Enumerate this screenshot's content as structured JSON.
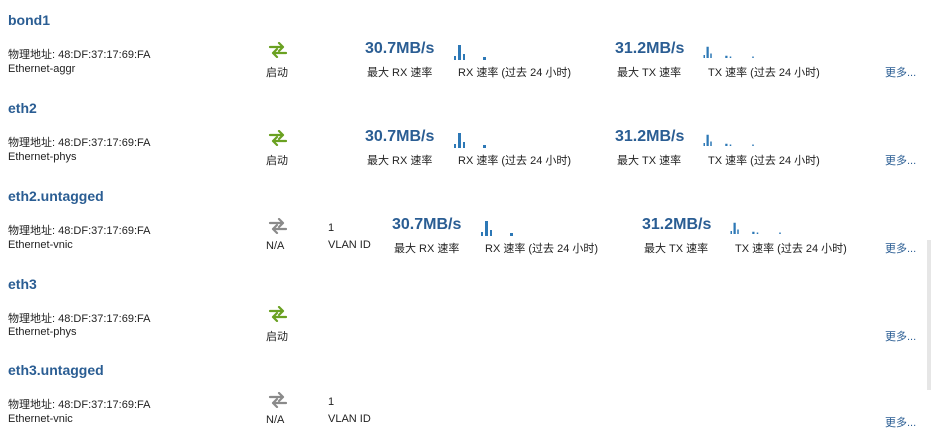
{
  "colors": {
    "link": "#2a5d93",
    "status_up": "#6aa121",
    "status_na": "#8a8a8a",
    "spark": "#2d78b6"
  },
  "labels": {
    "mac_prefix": "物理地址: ",
    "more": "更多...",
    "max_rx": "最大 RX 速率",
    "max_tx": "最大 TX 速率",
    "rx_24h": "RX 速率 (过去 24 小时)",
    "tx_24h": "TX 速率 (过去 24 小时)",
    "vlan_id": "VLAN ID"
  },
  "interfaces": [
    {
      "name": "bond1",
      "mac": "物理地址: 48:DF:37:17:69:FA",
      "type": "Ethernet-aggr",
      "status_icon": "link-up-icon",
      "status": "启动",
      "max_rx": "30.7MB/s",
      "max_tx": "31.2MB/s"
    },
    {
      "name": "eth2",
      "mac": "物理地址: 48:DF:37:17:69:FA",
      "type": "Ethernet-phys",
      "status_icon": "link-up-icon",
      "status": "启动",
      "max_rx": "30.7MB/s",
      "max_tx": "31.2MB/s"
    },
    {
      "name": "eth2.untagged",
      "mac": "物理地址: 48:DF:37:17:69:FA",
      "type": "Ethernet-vnic",
      "status_icon": "link-na-icon",
      "status": "N/A",
      "vlan_id": "1",
      "max_rx": "30.7MB/s",
      "max_tx": "31.2MB/s"
    },
    {
      "name": "eth3",
      "mac": "物理地址: 48:DF:37:17:69:FA",
      "type": "Ethernet-phys",
      "status_icon": "link-up-icon",
      "status": "启动"
    },
    {
      "name": "eth3.untagged",
      "mac": "物理地址: 48:DF:37:17:69:FA",
      "type": "Ethernet-vnic",
      "status_icon": "link-na-icon",
      "status": "N/A",
      "vlan_id": "1"
    }
  ]
}
